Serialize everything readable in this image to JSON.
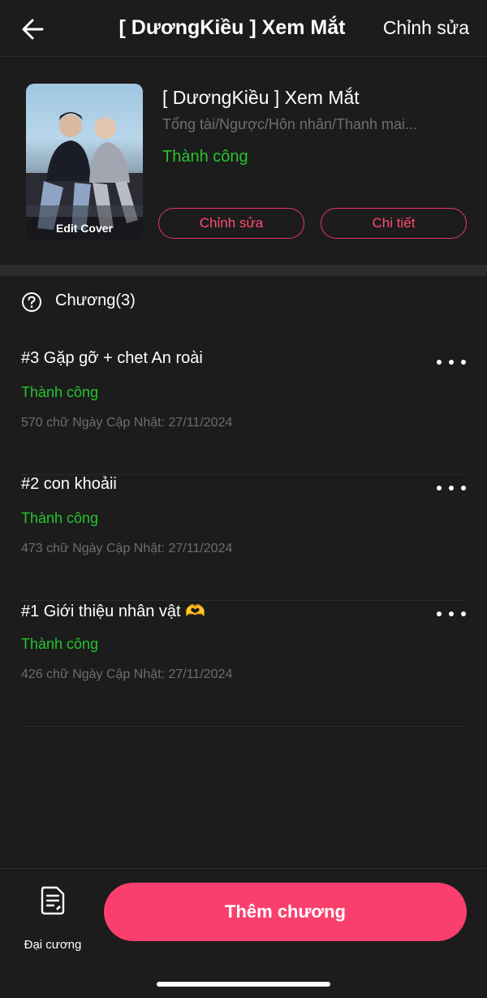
{
  "header": {
    "title": "[ DươngKiều ] Xem Mắt",
    "edit_label": "Chỉnh sửa"
  },
  "story": {
    "cover_label": "Edit Cover",
    "title": "[ DươngKiều ] Xem Mắt",
    "tags": "Tổng tài/Ngược/Hôn nhân/Thanh mai...",
    "status": "Thành công",
    "edit_button": "Chỉnh sửa",
    "detail_button": "Chi tiết"
  },
  "chapters": {
    "title": "Chương(3)",
    "items": [
      {
        "title": "#3 Gặp gỡ + chet An roài",
        "status": "Thành công",
        "meta": "570 chữ Ngày Cập Nhật: 27/11/2024"
      },
      {
        "title": "#2 con khoảii",
        "status": "Thành công",
        "meta": "473 chữ Ngày Cập Nhật: 27/11/2024"
      },
      {
        "title": "#1 Giới thiệu nhân vật 🫶",
        "status": "Thành công",
        "meta": "426 chữ Ngày Cập Nhật: 27/11/2024"
      }
    ]
  },
  "bottom": {
    "outline_label": "Đại cương",
    "add_chapter": "Thêm chương"
  },
  "colors": {
    "background": "#1c1c1c",
    "success": "#26c42f",
    "accent": "#fb3f6c",
    "muted": "#6d6d6d"
  },
  "icons": [
    "back-arrow-icon",
    "help-circle-icon",
    "more-horizontal-icon",
    "document-outline-icon"
  ]
}
